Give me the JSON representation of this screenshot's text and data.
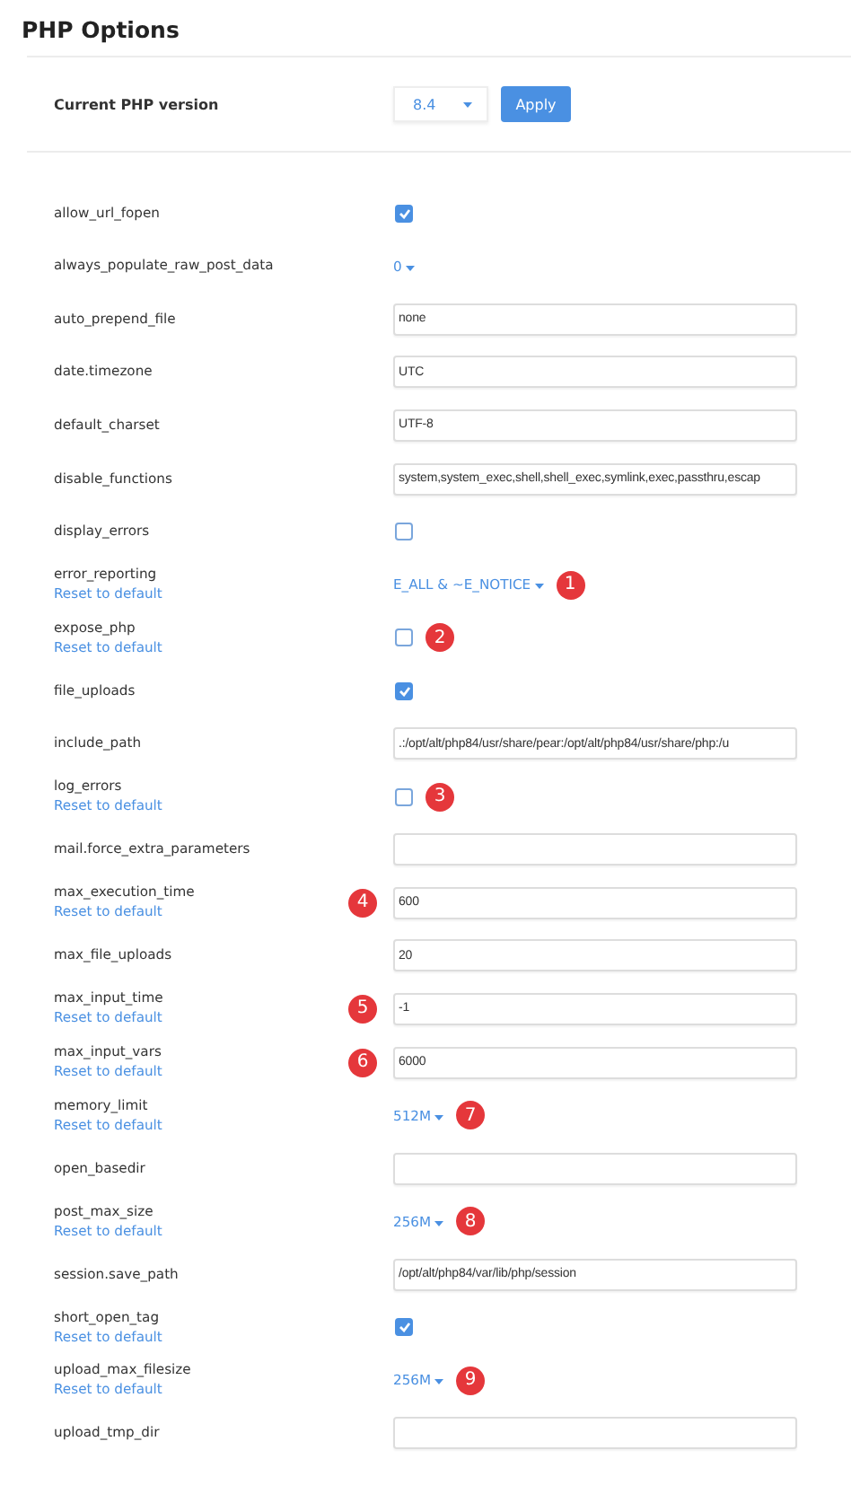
{
  "title": "PHP Options",
  "version": {
    "label": "Current PHP version",
    "value": "8.4",
    "button": "Apply"
  },
  "options": [
    {
      "name": "allow_url_fopen",
      "kind": "checkbox",
      "checked": true
    },
    {
      "name": "always_populate_raw_post_data",
      "kind": "dropdown",
      "value": "0"
    },
    {
      "name": "auto_prepend_file",
      "kind": "input",
      "value": "none"
    },
    {
      "name": "date.timezone",
      "kind": "input",
      "value": "UTC"
    },
    {
      "name": "default_charset",
      "kind": "input",
      "value": "UTF-8"
    },
    {
      "name": "disable_functions",
      "kind": "input",
      "value": "system,system_exec,shell,shell_exec,symlink,exec,passthru,escap"
    },
    {
      "name": "display_errors",
      "kind": "checkbox",
      "checked": false
    },
    {
      "name": "error_reporting",
      "kind": "dropdown",
      "value": "E_ALL & ~E_NOTICE",
      "reset": "Reset to default",
      "marker": "1"
    },
    {
      "name": "expose_php",
      "kind": "checkbox",
      "checked": false,
      "reset": "Reset to default",
      "marker": "2"
    },
    {
      "name": "file_uploads",
      "kind": "checkbox",
      "checked": true
    },
    {
      "name": "include_path",
      "kind": "input",
      "value": ".:/opt/alt/php84/usr/share/pear:/opt/alt/php84/usr/share/php:/u"
    },
    {
      "name": "log_errors",
      "kind": "checkbox",
      "checked": false,
      "reset": "Reset to default",
      "marker": "3"
    },
    {
      "name": "mail.force_extra_parameters",
      "kind": "input"
    },
    {
      "name": "max_execution_time",
      "kind": "input",
      "value": "600",
      "reset": "Reset to default",
      "marker": "4"
    },
    {
      "name": "max_file_uploads",
      "kind": "input",
      "value": "20"
    },
    {
      "name": "max_input_time",
      "kind": "input",
      "value": "-1",
      "reset": "Reset to default",
      "marker": "5"
    },
    {
      "name": "max_input_vars",
      "kind": "input",
      "value": "6000",
      "reset": "Reset to default",
      "marker": "6"
    },
    {
      "name": "memory_limit",
      "kind": "dropdown",
      "value": "512M",
      "reset": "Reset to default",
      "marker": "7"
    },
    {
      "name": "open_basedir",
      "kind": "input"
    },
    {
      "name": "post_max_size",
      "kind": "dropdown",
      "value": "256M",
      "reset": "Reset to default",
      "marker": "8"
    },
    {
      "name": "session.save_path",
      "kind": "input",
      "value": "/opt/alt/php84/var/lib/php/session"
    },
    {
      "name": "short_open_tag",
      "kind": "checkbox",
      "checked": true,
      "reset": "Reset to default"
    },
    {
      "name": "upload_max_filesize",
      "kind": "dropdown",
      "value": "256M",
      "reset": "Reset to default",
      "marker": "9"
    },
    {
      "name": "upload_tmp_dir",
      "kind": "input"
    }
  ]
}
